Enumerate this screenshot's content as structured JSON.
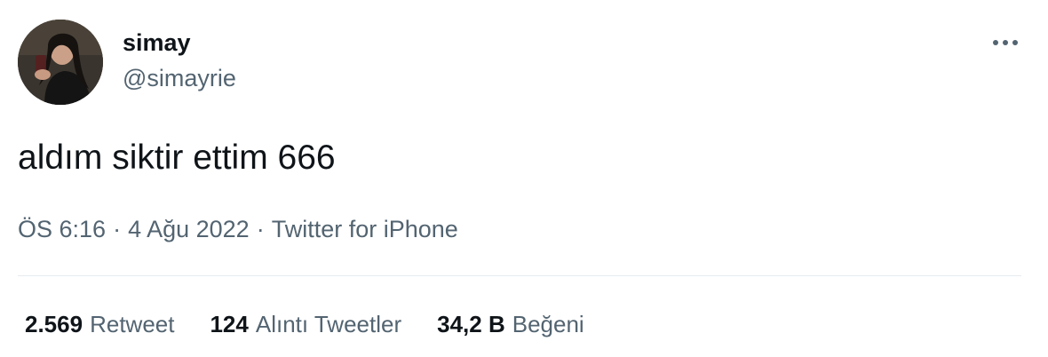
{
  "author": {
    "display_name": "simay",
    "handle": "@simayrie",
    "avatar_icon": "profile-photo"
  },
  "more_icon": "more-horizontal-icon",
  "tweet": {
    "text": "aldım siktir ettim 666"
  },
  "meta": {
    "time": "ÖS 6:16",
    "separator": "·",
    "date": "4 Ağu 2022",
    "source": "Twitter for iPhone"
  },
  "stats": [
    {
      "count": "2.569",
      "label": "Retweet"
    },
    {
      "count": "124",
      "label": "Alıntı Tweetler"
    },
    {
      "count": "34,2 B",
      "label": "Beğeni"
    }
  ],
  "colors": {
    "primary_text": "#0f1419",
    "secondary_text": "#536471",
    "divider": "#e6ebee"
  }
}
